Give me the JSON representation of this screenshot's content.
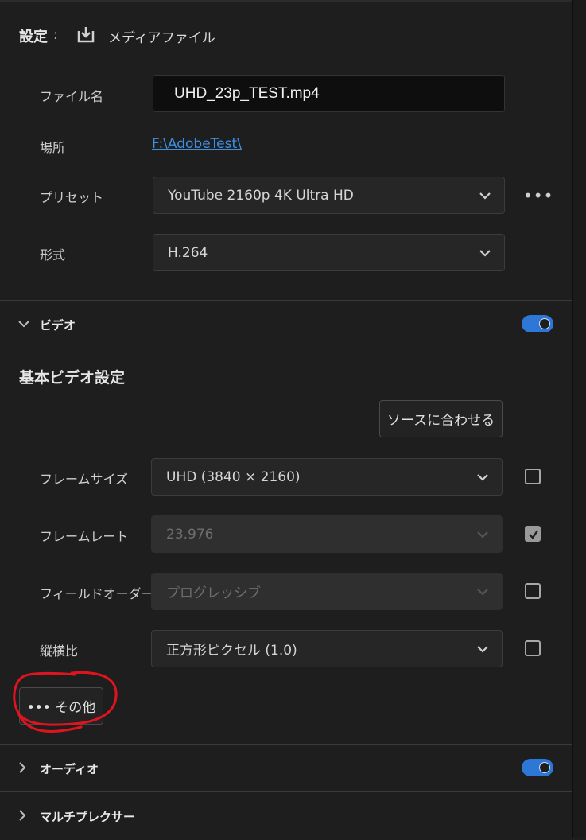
{
  "header": {
    "title": "設定",
    "colon": ":",
    "subtitle": "メディアファイル"
  },
  "output": {
    "filename_label": "ファイル名",
    "filename_value": "UHD_23p_TEST.mp4",
    "location_label": "場所",
    "location_value": "F:\\AdobeTest\\",
    "preset_label": "プリセット",
    "preset_value": "YouTube 2160p 4K Ultra HD",
    "preset_more": "•••",
    "format_label": "形式",
    "format_value": "H.264"
  },
  "video": {
    "section_label": "ビデオ",
    "enabled": true,
    "basic_title": "基本ビデオ設定",
    "match_source_label": "ソースに合わせる",
    "rows": [
      {
        "label": "フレームサイズ",
        "value": "UHD (3840 × 2160)",
        "disabled": false,
        "checked": false
      },
      {
        "label": "フレームレート",
        "value": "23.976",
        "disabled": true,
        "checked": true
      },
      {
        "label": "フィールドオーダー",
        "value": "プログレッシブ",
        "disabled": true,
        "checked": false
      },
      {
        "label": "縦横比",
        "value": "正方形ピクセル (1.0)",
        "disabled": false,
        "checked": false
      }
    ],
    "more_label": "••• その他"
  },
  "audio": {
    "section_label": "オーディオ",
    "enabled": true
  },
  "multiplexer": {
    "section_label": "マルチプレクサー"
  },
  "colors": {
    "accent": "#2d77d6",
    "link": "#3f8fe0",
    "annotation": "#e0141e"
  }
}
